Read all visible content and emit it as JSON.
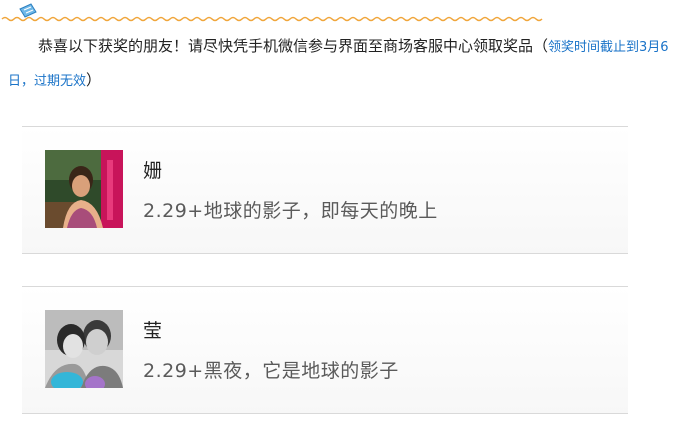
{
  "notice": {
    "main_text": "恭喜以下获奖的朋友！请尽快凭手机微信参与界面至商场客服中心领取奖品",
    "paren_open": "（",
    "deadline_text": "领奖时间截止到3月6日，过期无效",
    "paren_close": "）"
  },
  "winners": [
    {
      "name": "姗",
      "message": "2.29+地球的影子，即每天的晚上",
      "avatar": "winner-photo"
    },
    {
      "name": "莹",
      "message": "2.29+黑夜，它是地球的影子",
      "avatar": "couple-photo"
    }
  ],
  "colors": {
    "deadline_blue": "#1a73c8",
    "deco_orange": "#f0a53a",
    "divider": "#d9d9d9"
  }
}
